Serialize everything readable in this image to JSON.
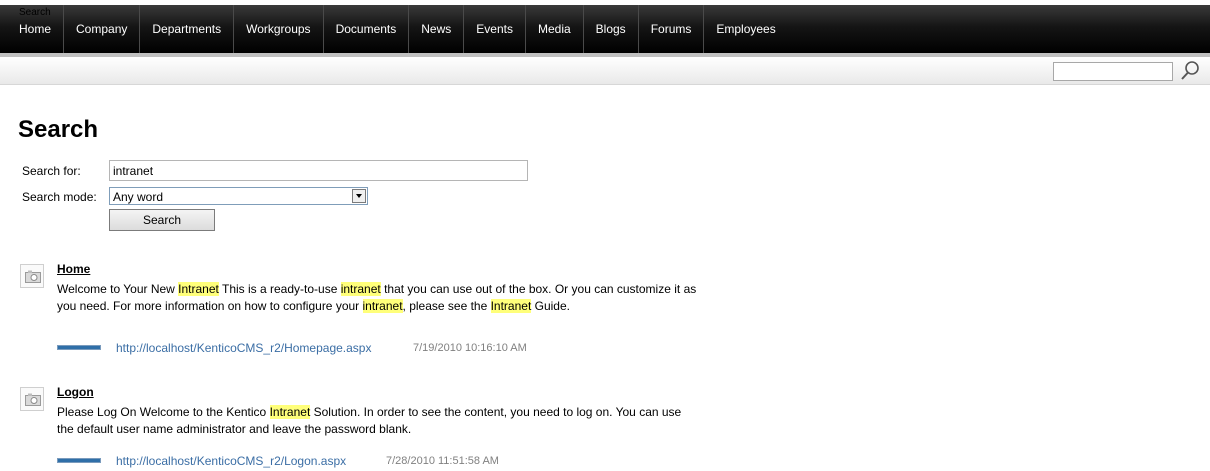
{
  "nav": {
    "items": [
      "Home",
      "Company",
      "Departments",
      "Workgroups",
      "Documents",
      "News",
      "Events",
      "Media",
      "Blogs",
      "Forums",
      "Employees"
    ]
  },
  "breadcrumb": "Search",
  "header_search": {
    "value": ""
  },
  "page": {
    "title": "Search"
  },
  "form": {
    "search_for_label": "Search for:",
    "search_for_value": "intranet",
    "search_mode_label": "Search mode:",
    "search_mode_value": "Any word",
    "search_button": "Search"
  },
  "results": [
    {
      "title": "Home",
      "body": [
        {
          "t": "Welcome to Your New "
        },
        {
          "t": "Intranet",
          "h": true
        },
        {
          "t": " This is a ready-to-use "
        },
        {
          "t": "intranet",
          "h": true
        },
        {
          "t": " that you can use out of the box. Or you can customize it as you need. For more information on how to configure your "
        },
        {
          "t": "intranet",
          "h": true
        },
        {
          "t": ", please see the "
        },
        {
          "t": "Intranet",
          "h": true
        },
        {
          "t": " Guide."
        }
      ],
      "url": "http://localhost/KenticoCMS_r2/Homepage.aspx",
      "date": "7/19/2010 10:16:10 AM",
      "relevance": 1.0
    },
    {
      "title": "Logon",
      "body": [
        {
          "t": "Please Log On Welcome to the Kentico "
        },
        {
          "t": "Intranet",
          "h": true
        },
        {
          "t": " Solution. In order to see the content, you need to log on. You can use the default user name administrator and leave the password blank."
        }
      ],
      "url": "http://localhost/KenticoCMS_r2/Logon.aspx",
      "date": "7/28/2010 11:51:58 AM",
      "relevance": 1.0
    }
  ],
  "colors": {
    "nav_bg": "#000000",
    "link": "#3b6ea5",
    "highlight": "#ffff7a",
    "relevance": "#2f6fa8"
  }
}
